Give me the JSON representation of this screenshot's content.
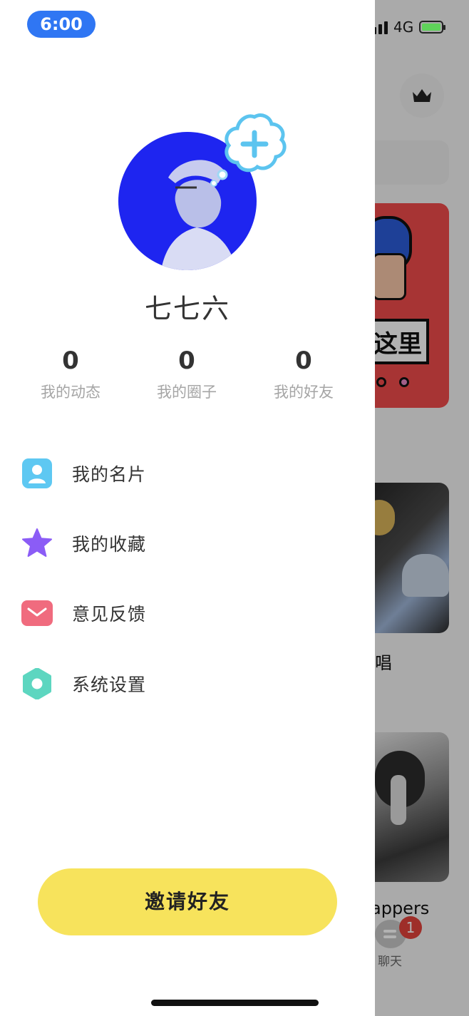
{
  "status_bar": {
    "time": "6:00",
    "network": "4G"
  },
  "profile": {
    "name": "七七六"
  },
  "stats": [
    {
      "count": "0",
      "label": "我的动态"
    },
    {
      "count": "0",
      "label": "我的圈子"
    },
    {
      "count": "0",
      "label": "我的好友"
    }
  ],
  "menu": [
    {
      "label": "我的名片",
      "icon": "contact-card-icon",
      "color": "#5ec8f2"
    },
    {
      "label": "我的收藏",
      "icon": "star-icon",
      "color": "#8b5cf6"
    },
    {
      "label": "意见反馈",
      "icon": "mail-icon",
      "color": "#f06b7e"
    },
    {
      "label": "系统设置",
      "icon": "gear-icon",
      "color": "#5dd6c0"
    }
  ],
  "invite_button": {
    "label": "邀请好友",
    "color": "#f7e35c"
  },
  "background": {
    "card1_sign": "这里",
    "card2_caption": "唱",
    "card3_caption": "appers",
    "chat_label": "聊天",
    "chat_badge": "1"
  }
}
